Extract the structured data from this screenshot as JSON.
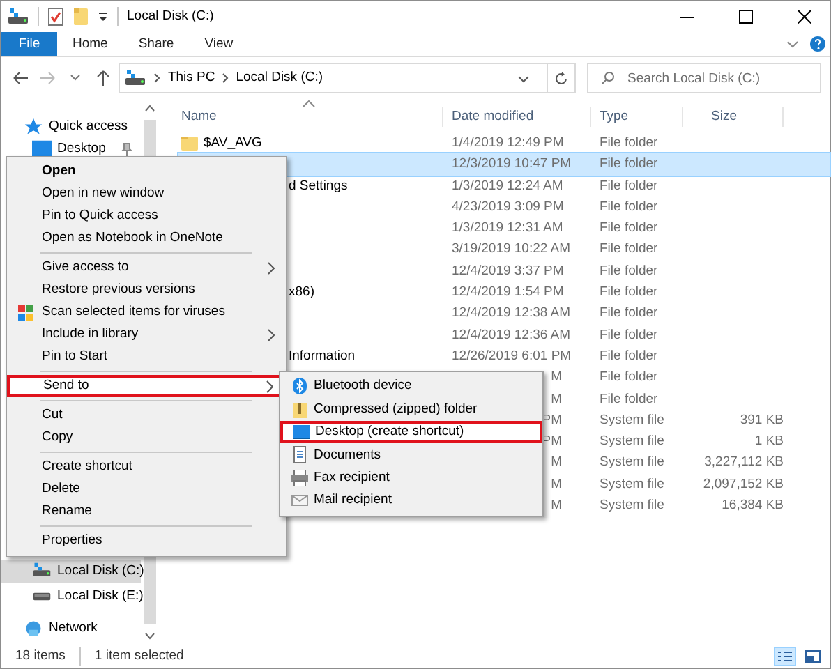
{
  "window": {
    "title": "Local Disk (C:)"
  },
  "ribbon": {
    "file_button": "File",
    "tabs": [
      {
        "label": "Home",
        "selected": false
      },
      {
        "label": "Share",
        "selected": false
      },
      {
        "label": "View",
        "selected": false
      }
    ]
  },
  "address_bar": {
    "path": [
      "This PC",
      "Local Disk (C:)"
    ]
  },
  "search": {
    "placeholder": "Search Local Disk (C:)"
  },
  "navigation": {
    "top": [
      {
        "label": "Quick access",
        "kind": "star",
        "selected": false
      },
      {
        "label": "Desktop",
        "kind": "desktop",
        "pinned": true,
        "selected": false
      }
    ],
    "bottom": [
      {
        "label": "Local Disk (C:)",
        "kind": "drive",
        "selected": true
      },
      {
        "label": "Local Disk (E:)",
        "kind": "drive2",
        "selected": false
      },
      {
        "label": "Network",
        "kind": "network",
        "selected": false
      }
    ]
  },
  "file_list": {
    "columns": [
      "Name",
      "Date modified",
      "Type",
      "Size"
    ],
    "rows": [
      {
        "name": "$AV_AVG",
        "date": "1/4/2019 12:49 PM",
        "type": "File folder",
        "selected": false
      },
      {
        "date": "12/3/2019 10:47 PM",
        "type": "File folder",
        "selected": true
      },
      {
        "name": "d Settings",
        "name_clipped": true,
        "date": "1/3/2019 12:24 AM",
        "type": "File folder",
        "selected": false
      },
      {
        "date": "4/23/2019 3:09 PM",
        "type": "File folder",
        "selected": false
      },
      {
        "date": "1/3/2019 12:31 AM",
        "type": "File folder",
        "selected": false
      },
      {
        "date": "3/19/2019 10:22 AM",
        "type": "File folder",
        "selected": false
      },
      {
        "date": "12/4/2019 3:37 PM",
        "type": "File folder",
        "selected": false
      },
      {
        "name": "x86)",
        "name_clipped": true,
        "date": "12/4/2019 1:54 PM",
        "type": "File folder",
        "selected": false
      },
      {
        "date": "12/4/2019 12:38 AM",
        "type": "File folder",
        "selected": false
      },
      {
        "date": "12/4/2019 12:36 AM",
        "type": "File folder",
        "selected": false
      },
      {
        "name": "Information",
        "name_clipped": true,
        "date": "12/26/2019 6:01 PM",
        "type": "File folder",
        "selected": false
      },
      {
        "date": "M",
        "date_clipped": true,
        "type": "File folder",
        "selected": false
      },
      {
        "date": "M",
        "date_clipped": true,
        "type": "File folder",
        "selected": false
      },
      {
        "date": "PM",
        "date_clipped": true,
        "type": "System file",
        "size": "391 KB",
        "selected": false
      },
      {
        "date": "PM",
        "date_clipped": true,
        "type": "System file",
        "size": "1 KB",
        "selected": false
      },
      {
        "date": "M",
        "date_clipped": true,
        "type": "System file",
        "size": "3,227,112 KB",
        "selected": false
      },
      {
        "date": "M",
        "date_clipped": true,
        "type": "System file",
        "size": "2,097,152 KB",
        "selected": false
      },
      {
        "date": "M",
        "date_clipped": true,
        "type": "System file",
        "size": "16,384 KB",
        "selected": false
      }
    ]
  },
  "context_menu": [
    {
      "kind": "command",
      "label": "Open",
      "default": true,
      "selected": false
    },
    {
      "kind": "command",
      "label": "Open in new window",
      "selected": false
    },
    {
      "kind": "command",
      "label": "Pin to Quick access",
      "selected": false
    },
    {
      "kind": "command",
      "label": "Open as Notebook in OneNote",
      "selected": false
    },
    {
      "kind": "separator"
    },
    {
      "kind": "command",
      "label": "Give access to",
      "submenu": true,
      "selected": false
    },
    {
      "kind": "command",
      "label": "Restore previous versions",
      "selected": false
    },
    {
      "kind": "command",
      "label": "Scan selected items for viruses",
      "icon": true,
      "selected": false
    },
    {
      "kind": "command",
      "label": "Include in library",
      "submenu": true,
      "selected": false
    },
    {
      "kind": "command",
      "label": "Pin to Start",
      "selected": false
    },
    {
      "kind": "separator"
    },
    {
      "kind": "command",
      "label": "Send to",
      "submenu": true,
      "selected": true
    },
    {
      "kind": "separator"
    },
    {
      "kind": "command",
      "label": "Cut",
      "selected": false
    },
    {
      "kind": "command",
      "label": "Copy",
      "selected": false
    },
    {
      "kind": "separator"
    },
    {
      "kind": "command",
      "label": "Create shortcut",
      "selected": false
    },
    {
      "kind": "command",
      "label": "Delete",
      "selected": false
    },
    {
      "kind": "command",
      "label": "Rename",
      "selected": false
    },
    {
      "kind": "separator"
    },
    {
      "kind": "command",
      "label": "Properties",
      "selected": false
    }
  ],
  "send_to_menu": [
    {
      "kind": "bluetooth",
      "label": "Bluetooth device",
      "selected": false
    },
    {
      "kind": "zip",
      "label": "Compressed (zipped) folder",
      "selected": false
    },
    {
      "kind": "desktop",
      "label": "Desktop (create shortcut)",
      "selected": true
    },
    {
      "kind": "documents",
      "label": "Documents",
      "selected": false
    },
    {
      "kind": "fax",
      "label": "Fax recipient",
      "selected": false
    },
    {
      "kind": "mail",
      "label": "Mail recipient",
      "selected": false
    }
  ],
  "status_bar": {
    "item_count": "18 items",
    "selection": "1 item selected",
    "views": [
      {
        "kind": "details",
        "selected": true
      },
      {
        "kind": "large",
        "selected": false
      }
    ]
  }
}
